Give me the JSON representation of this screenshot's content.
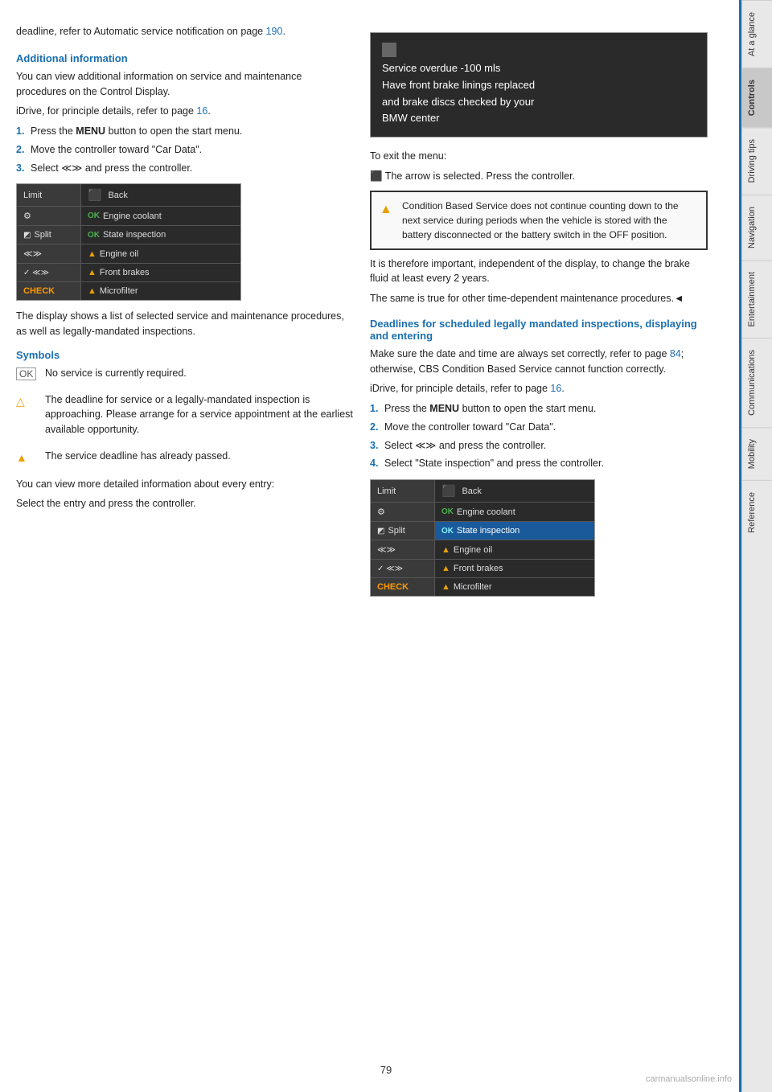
{
  "page": {
    "number": "79"
  },
  "sidebar": {
    "tabs": [
      {
        "label": "At a glance",
        "active": false
      },
      {
        "label": "Controls",
        "active": true
      },
      {
        "label": "Driving tips",
        "active": false
      },
      {
        "label": "Navigation",
        "active": false
      },
      {
        "label": "Entertainment",
        "active": false
      },
      {
        "label": "Communications",
        "active": false
      },
      {
        "label": "Mobility",
        "active": false
      },
      {
        "label": "Reference",
        "active": false
      }
    ]
  },
  "left_column": {
    "intro_text": "deadline, refer to Automatic service notification on page 190.",
    "intro_link": "190",
    "additional_info": {
      "heading": "Additional information",
      "para1": "You can view additional information on service and maintenance procedures on the Control Display.",
      "idrive_ref": "iDrive, for principle details, refer to page 16.",
      "idrive_link": "16",
      "steps": [
        {
          "num": "1.",
          "text": "Press the ",
          "bold": "MENU",
          "text2": " button to open the start menu."
        },
        {
          "num": "2.",
          "text": "Move the controller toward \"Car Data\"."
        },
        {
          "num": "3.",
          "text": "Select ",
          "icon": "≪≫",
          "text2": " and press the controller."
        }
      ]
    },
    "menu_image": {
      "rows": [
        {
          "left": "Limit",
          "left_icon": "back",
          "right": "Back",
          "highlighted": false
        },
        {
          "left": "⚙",
          "left_icon": "",
          "right": "Engine coolant",
          "status": "OK",
          "highlighted": false
        },
        {
          "left": "◩ Split",
          "left_icon": "",
          "right": "State inspection",
          "status": "OK",
          "highlighted": false
        },
        {
          "left": "≪≫",
          "left_icon": "",
          "right": "Engine oil",
          "status": "warn",
          "highlighted": false
        },
        {
          "left": "✓ ≪≫",
          "left_icon": "",
          "right": "Front brakes",
          "status": "warn",
          "highlighted": false
        },
        {
          "left": "CHECK",
          "left_icon": "",
          "right": "Microfilter",
          "status": "warn",
          "highlighted": false
        }
      ]
    },
    "display_text": "The display shows a list of selected service and maintenance procedures, as well as legally-mandated inspections.",
    "symbols_heading": "Symbols",
    "symbols": [
      {
        "sym": "OK",
        "text": "No service is currently required."
      },
      {
        "sym": "△",
        "text": "The deadline for service or a legally-mandated inspection is approaching. Please arrange for a service appointment at the earliest available opportunity."
      },
      {
        "sym": "▲",
        "text": "The service deadline has already passed."
      }
    ],
    "view_more_text": "You can view more detailed information about every entry:",
    "select_text": "Select the entry and press the controller."
  },
  "right_column": {
    "service_overdue": {
      "header_icon": "□",
      "lines": [
        "Service overdue -100 mls",
        "Have front brake linings replaced",
        "and brake discs checked by your",
        "BMW center"
      ]
    },
    "exit_menu_text": "To exit the menu:",
    "exit_arrow_text": "The arrow is selected. Press the controller.",
    "alert_text": "Condition Based Service does not continue counting down to the next service during periods when the vehicle is stored with the battery disconnected or the battery switch in the OFF position.",
    "important_text": "It is therefore important, independent of the display, to change the brake fluid at least every 2 years.",
    "same_true_text": "The same is true for other time-dependent maintenance procedures.◄",
    "deadlines_heading": "Deadlines for scheduled legally mandated inspections, displaying and entering",
    "deadlines_para": "Make sure the date and time are always set correctly, refer to page 84; otherwise, CBS Condition Based Service cannot function correctly.",
    "deadlines_link": "84",
    "idrive_ref2": "iDrive, for principle details, refer to page 16.",
    "idrive_link2": "16",
    "steps2": [
      {
        "num": "1.",
        "text": "Press the ",
        "bold": "MENU",
        "text2": " button to open the start menu."
      },
      {
        "num": "2.",
        "text": "Move the controller toward \"Car Data\"."
      },
      {
        "num": "3.",
        "text": "Select ",
        "icon": "≪≫",
        "text2": " and press the controller."
      },
      {
        "num": "4.",
        "text": "Select \"State inspection\" and press the controller."
      }
    ],
    "menu_image2": {
      "rows": [
        {
          "left": "Limit",
          "left_icon": "back",
          "right": "Back",
          "highlighted": false
        },
        {
          "left": "⚙",
          "right": "Engine coolant",
          "status": "OK",
          "highlighted": false
        },
        {
          "left": "◩ Split",
          "right": "State inspection",
          "status": "OK",
          "highlighted": true
        },
        {
          "left": "≪≫",
          "right": "Engine oil",
          "status": "warn",
          "highlighted": false
        },
        {
          "left": "✓ ≪≫",
          "right": "Front brakes",
          "status": "warn",
          "highlighted": false
        },
        {
          "left": "CHECK",
          "right": "Microfilter",
          "status": "warn",
          "highlighted": false
        }
      ]
    }
  }
}
